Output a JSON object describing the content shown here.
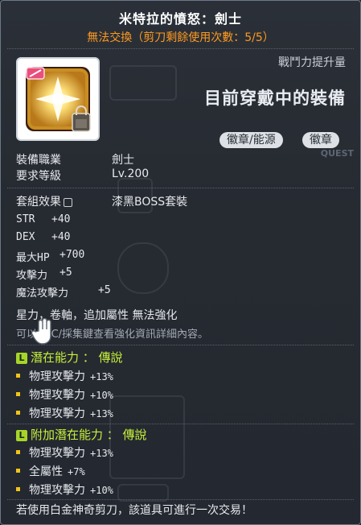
{
  "item": {
    "name": "米特拉的憤怒：劍士",
    "trade_status": "無法交換（剪刀剩餘使用次數：5/5）"
  },
  "compare": {
    "power_label": "戰鬥力提升量",
    "current_label": "目前穿戴中的裝備",
    "tags": [
      "徽章/能源",
      "徽章"
    ],
    "bg_text": "QUEST"
  },
  "requirements": {
    "job_label": "裝備職業",
    "job_value": "劍士",
    "level_label": "要求等級",
    "level_value": "Lv.200"
  },
  "set": {
    "label": "套組效果",
    "value": "漆黑BOSS套裝"
  },
  "stats": [
    {
      "name": "STR",
      "value": "+40"
    },
    {
      "name": "DEX",
      "value": "+40"
    },
    {
      "name": "最大HP",
      "value": "+700"
    },
    {
      "name": "攻擊力",
      "value": "+5"
    },
    {
      "name": "魔法攻擊力",
      "value": "+5"
    }
  ],
  "flags": "星力，卷軸，追加屬性 無法強化",
  "hint": "可以NPC/採集鍵查看強化資訊詳細內容。",
  "potential": {
    "header": "潛在能力 ： 傳說",
    "badge": "L",
    "lines": [
      {
        "name": "物理攻擊力",
        "value": "+13%"
      },
      {
        "name": "物理攻擊力",
        "value": "+10%"
      },
      {
        "name": "物理攻擊力",
        "value": "+13%"
      }
    ]
  },
  "additional_potential": {
    "header": "附加潛在能力 ： 傳說",
    "badge": "L",
    "lines": [
      {
        "name": "物理攻擊力",
        "value": "+13%"
      },
      {
        "name": "全屬性",
        "value": "+7%"
      },
      {
        "name": "物理攻擊力",
        "value": "+10%"
      }
    ]
  },
  "footer": "若使用白金神奇剪刀，該道具可進行一次交易！",
  "colors": {
    "title": "#ffffff",
    "trade_status": "#ff9a1f",
    "potential_header": "#c6f03b",
    "bullet": "#f0c419"
  }
}
